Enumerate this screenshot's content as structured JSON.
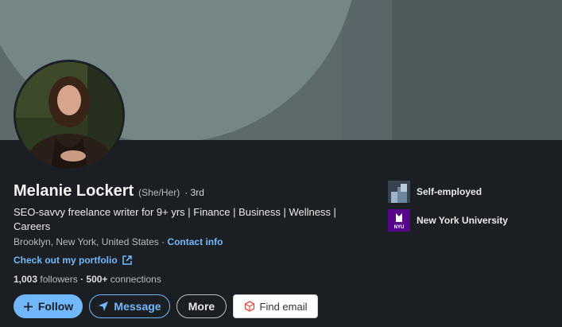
{
  "profile": {
    "name": "Melanie Lockert",
    "pronouns": "(She/Her)",
    "degree": "· 3rd",
    "headline": "SEO-savvy freelance writer for 9+ yrs | Finance | Business | Wellness | Careers",
    "location": "Brooklyn, New York, United States ·",
    "contact_info": "Contact info",
    "portfolio_link": "Check out my portfolio",
    "followers_count": "1,003",
    "followers_label": "followers",
    "connections_count": "· 500+",
    "connections_label": "connections"
  },
  "actions": {
    "follow": "Follow",
    "message": "Message",
    "more": "More",
    "find_email": "Find email"
  },
  "experience": {
    "current": "Self-employed"
  },
  "education": {
    "school": "New York University",
    "logo_text": "NYU"
  },
  "colors": {
    "background": "#1b1f23",
    "accent": "#71b7fb",
    "nyu_purple": "#57068c"
  },
  "icons": [
    "plus-icon",
    "send-icon",
    "external-link-icon",
    "find-email-icon",
    "company-logo",
    "nyu-logo"
  ]
}
